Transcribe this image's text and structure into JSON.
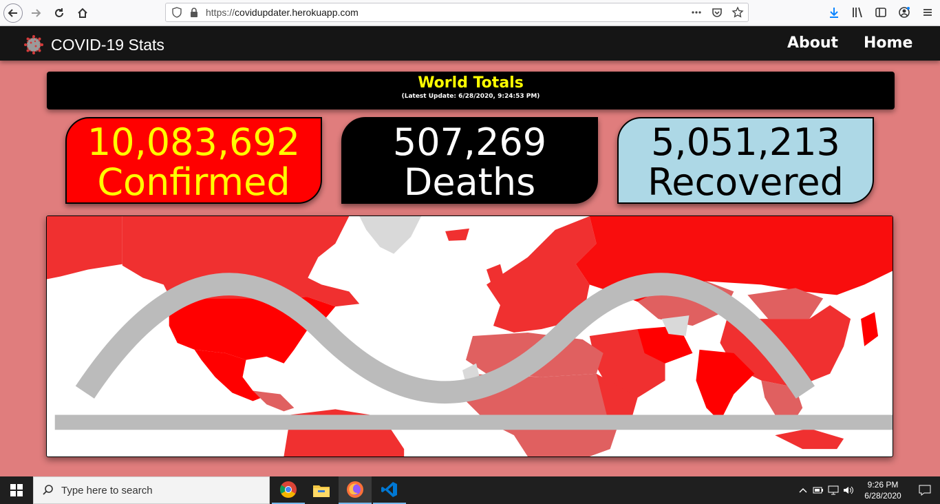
{
  "browser": {
    "url_scheme": "https://",
    "url_host": "covidupdater.herokuapp.com",
    "icons": [
      "back-icon",
      "forward-icon",
      "reload-icon",
      "home-icon",
      "shield-icon",
      "lock-icon",
      "more-icon",
      "pocket-icon",
      "bookmark-star-icon",
      "download-icon",
      "library-icon",
      "sidebar-icon",
      "account-icon",
      "menu-icon"
    ]
  },
  "navbar": {
    "brand": "COVID-19 Stats",
    "links": [
      "About",
      "Home"
    ]
  },
  "totals": {
    "title": "World Totals",
    "update": "(Latest Update: 6/28/2020, 9:24:53 PM)"
  },
  "cards": {
    "confirmed": {
      "value": "10,083,692",
      "label": "Confirmed",
      "bg": "#ff0000",
      "fg": "#ffff00"
    },
    "deaths": {
      "value": "507,269",
      "label": "Deaths",
      "bg": "#000000",
      "fg": "#ffffff"
    },
    "recovered": {
      "value": "5,051,213",
      "label": "Recovered",
      "bg": "#add8e6",
      "fg": "#000000"
    }
  },
  "map": {
    "colors": {
      "high": "#ff0000",
      "mid": "#f03030",
      "low": "#e06060",
      "none": "#d9d9d9",
      "water": "#ffffff"
    }
  },
  "taskbar": {
    "search_placeholder": "Type here to search",
    "apps": [
      "chrome-icon",
      "file-explorer-icon",
      "firefox-icon",
      "vscode-icon"
    ],
    "time": "9:26 PM",
    "date": "6/28/2020"
  }
}
